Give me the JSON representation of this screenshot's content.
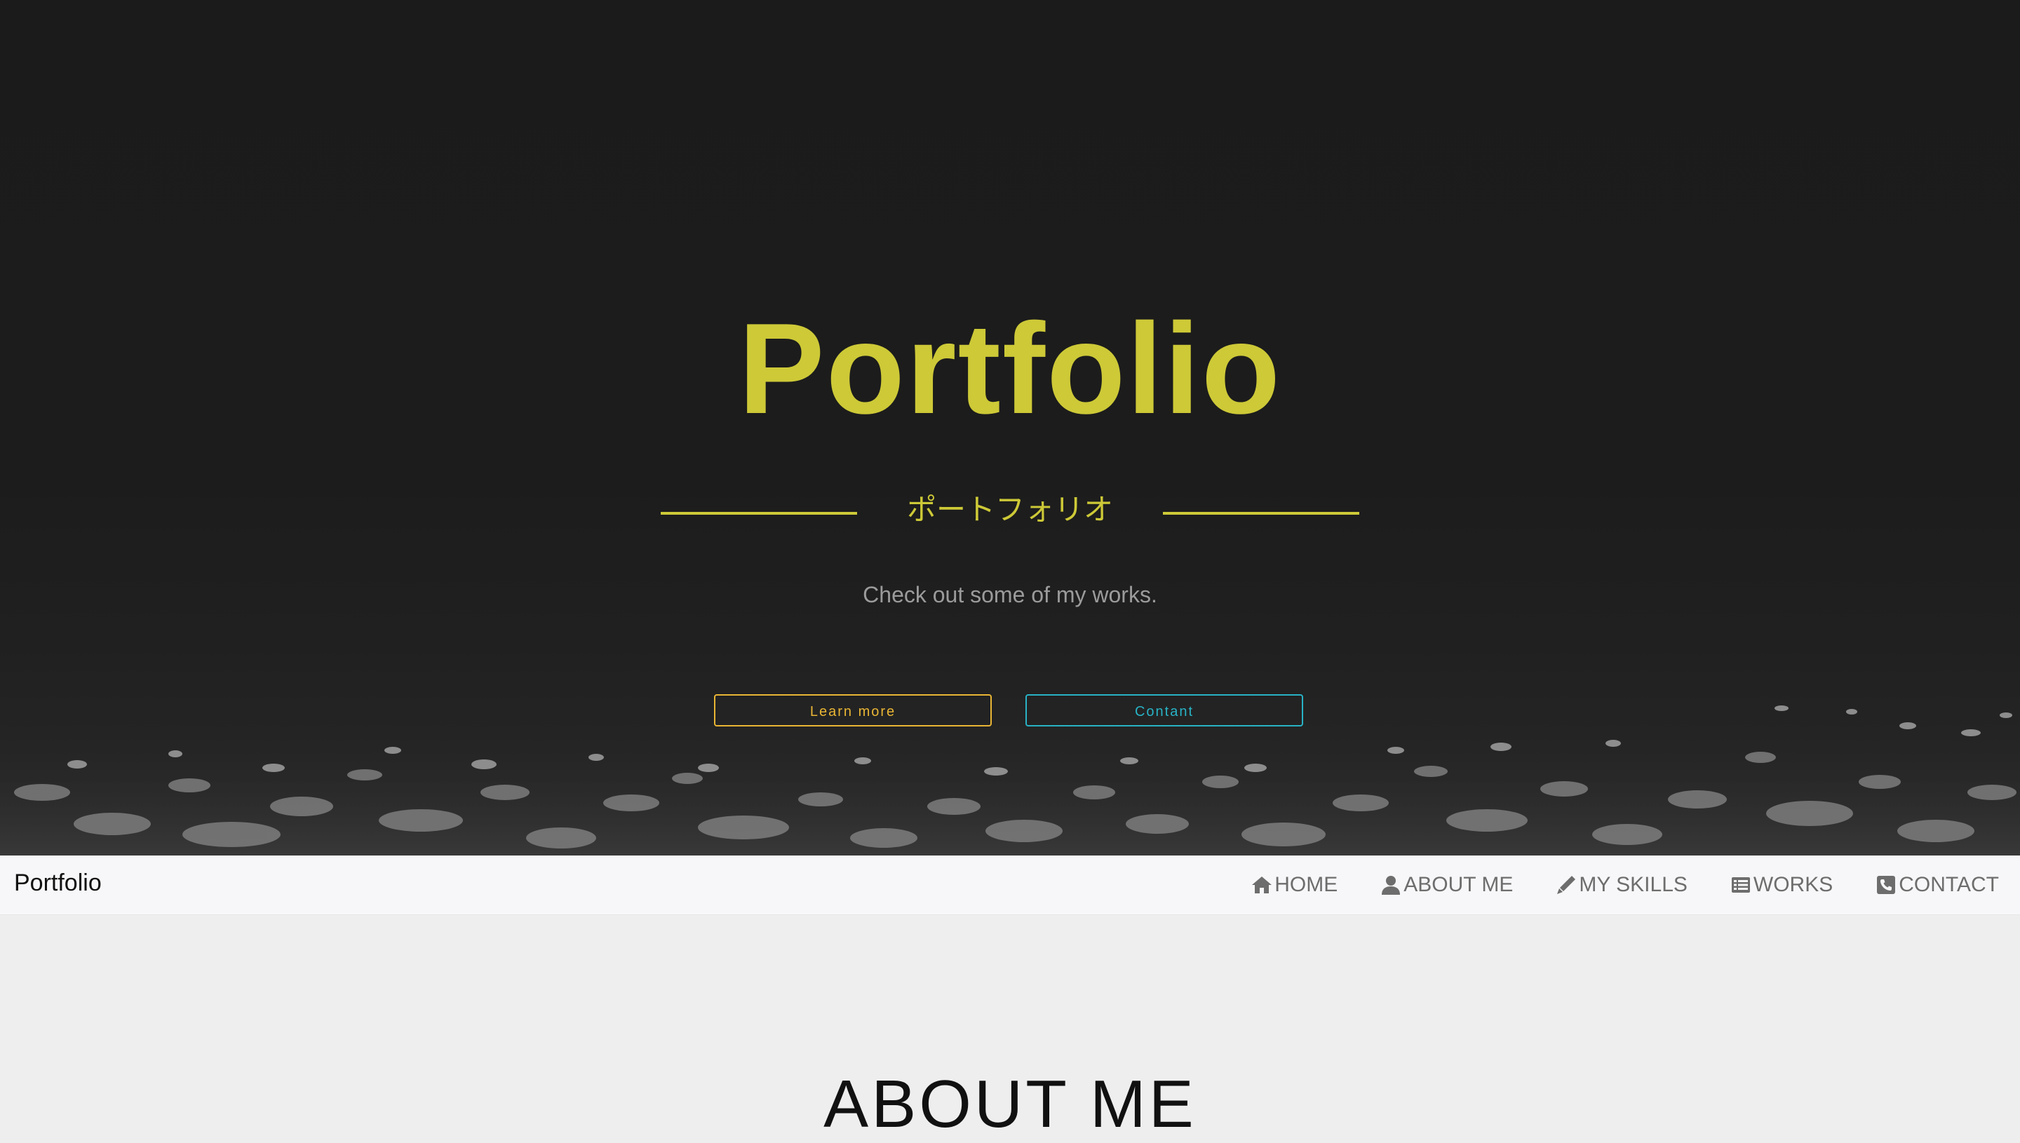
{
  "hero": {
    "title": "Portfolio",
    "subtitle": "ポートフォリオ",
    "description": "Check out some of my works.",
    "learn_more_label": "Learn more",
    "contact_label": "Contant"
  },
  "navbar": {
    "brand": "Portfolio",
    "items": [
      {
        "label": "HOME",
        "icon": "home-icon"
      },
      {
        "label": "ABOUT ME",
        "icon": "user-icon"
      },
      {
        "label": "MY SKILLS",
        "icon": "pen-icon"
      },
      {
        "label": "WORKS",
        "icon": "list-icon"
      },
      {
        "label": "CONTACT",
        "icon": "phone-icon"
      }
    ]
  },
  "about": {
    "heading": "ABOUT ME"
  },
  "colors": {
    "accent_yellow": "#cdc937",
    "button_orange": "#e9b534",
    "button_teal": "#28b3c6",
    "hero_bg": "#1c1c1c",
    "navbar_bg": "#f7f7f9",
    "page_bg": "#eeeeee"
  }
}
